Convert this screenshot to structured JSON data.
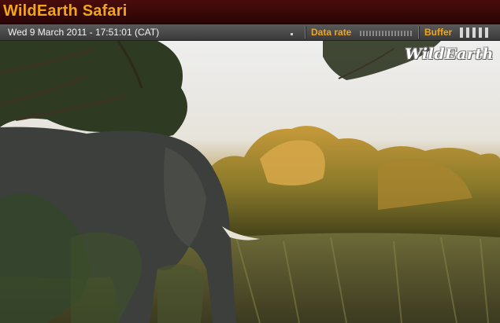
{
  "header": {
    "title": "WildEarth Safari"
  },
  "status": {
    "datetime": "Wed 9 March 2011 - 17:51:01 (CAT)",
    "data_rate_label": "Data rate",
    "buffer_label": "Buffer",
    "buffer_level": 1.0
  },
  "video": {
    "watermark": "WildEarth"
  },
  "colors": {
    "accent": "#f0a51a",
    "titlebar": "#3a0808",
    "statusbar": "#4a4a4a"
  }
}
